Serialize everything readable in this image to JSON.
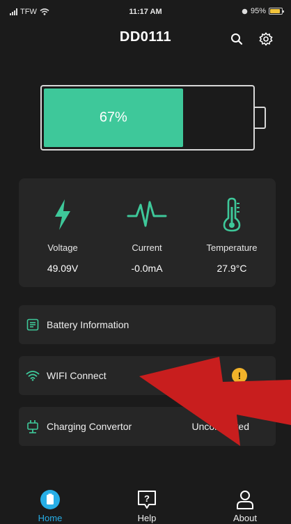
{
  "status_bar": {
    "carrier": "TFW",
    "time": "11:17 AM",
    "battery": "95%"
  },
  "header": {
    "title": "DD0111",
    "search_icon": "search-icon",
    "settings_icon": "gear-icon"
  },
  "battery": {
    "percent_label": "67%",
    "level": 0.67,
    "fill_color": "#3ec89a"
  },
  "metrics": [
    {
      "label": "Voltage",
      "value": "49.09V",
      "icon": "lightning-bolt-icon"
    },
    {
      "label": "Current",
      "value": "-0.0mA",
      "icon": "pulse-icon"
    },
    {
      "label": "Temperature",
      "value": "27.9°C",
      "icon": "thermometer-icon"
    }
  ],
  "rows": {
    "battery_info": {
      "label": "Battery Information",
      "icon": "battery-info-icon"
    },
    "wifi": {
      "label": "WIFI Connect",
      "icon": "wifi-icon",
      "badge": "!"
    },
    "charging": {
      "label": "Charging Convertor",
      "value": "Unconnected",
      "icon": "charger-icon"
    }
  },
  "tabs": [
    {
      "label": "Home",
      "icon": "home-icon",
      "active": true
    },
    {
      "label": "Help",
      "icon": "help-icon",
      "active": false
    },
    {
      "label": "About",
      "icon": "user-icon",
      "active": false
    }
  ],
  "colors": {
    "accent": "#3ec89a",
    "tab_active": "#27aee6",
    "warning": "#f2b32a",
    "overlay_arrow": "#c81e1e"
  }
}
